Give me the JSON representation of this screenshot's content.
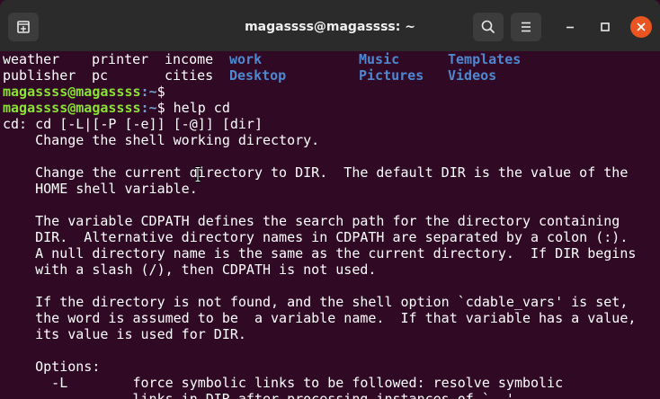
{
  "window": {
    "title": "magassss@magassss: ~"
  },
  "listing": {
    "rows": [
      [
        "weather",
        "printer",
        "income",
        "work",
        "Music",
        "Templates"
      ],
      [
        "publisher",
        "pc",
        "cities",
        "Desktop",
        "Pictures",
        "Videos"
      ]
    ],
    "dir_color": "#4f87d1"
  },
  "prompt": {
    "user": "magassss@magassss",
    "path": ":~",
    "symbol": "$",
    "user_color": "#8ae234",
    "path_color": "#729fcf"
  },
  "commands": [
    "",
    " help cd"
  ],
  "output_lines": [
    "cd: cd [-L|[-P [-e]] [-@]] [dir]",
    "    Change the shell working directory.",
    "",
    "    Change the current directory to DIR.  The default DIR is the value of the",
    "    HOME shell variable.",
    "",
    "    The variable CDPATH defines the search path for the directory containing",
    "    DIR.  Alternative directory names in CDPATH are separated by a colon (:).",
    "    A null directory name is the same as the current directory.  If DIR begins",
    "    with a slash (/), then CDPATH is not used.",
    "",
    "    If the directory is not found, and the shell option `cdable_vars' is set,",
    "    the word is assumed to be  a variable name.  If that variable has a value,",
    "    its value is used for DIR.",
    "",
    "    Options:",
    "      -L        force symbolic links to be followed: resolve symbolic",
    "                links in DIR after processing instances of `..'"
  ],
  "icons": {
    "new_tab": "new-tab-icon",
    "search": "search-icon",
    "menu": "hamburger-menu-icon",
    "minimize": "minimize-icon",
    "maximize": "maximize-icon",
    "close": "close-icon",
    "text_cursor": "text-cursor-icon"
  },
  "colors": {
    "terminal_bg": "#300a24",
    "titlebar_bg": "#2b2b2b",
    "close_accent": "#e95420",
    "text": "#ffffff"
  }
}
